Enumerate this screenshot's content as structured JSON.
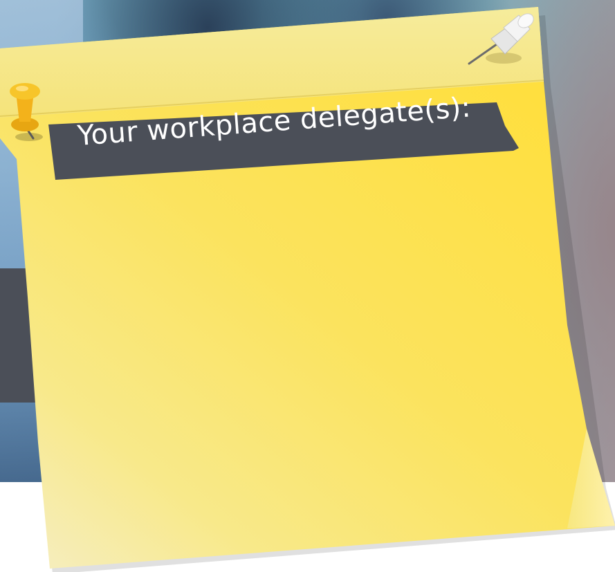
{
  "note": {
    "heading": "Your workplace delegate(s):"
  },
  "colors": {
    "note_yellow": "#fbe36a",
    "note_light": "#fdf2a8",
    "ribbon": "#4b4f58",
    "pin_yellow": "#f5c018",
    "pin_white": "#f2f2f2"
  },
  "icons": {
    "right_pin": "push-pin-icon",
    "left_pin": "thumbtack-icon"
  }
}
